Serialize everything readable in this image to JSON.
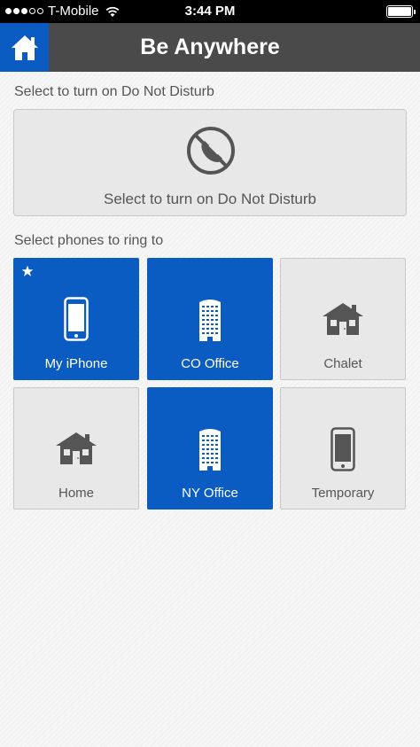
{
  "status_bar": {
    "carrier": "T-Mobile",
    "time": "3:44 PM"
  },
  "header": {
    "title": "Be Anywhere",
    "home_icon": "home-icon"
  },
  "dnd": {
    "section_label": "Select to turn on Do Not Disturb",
    "button_label": "Select to turn on Do Not Disturb",
    "icon": "phone-blocked-icon"
  },
  "phones": {
    "section_label": "Select phones to ring to",
    "items": [
      {
        "label": "My iPhone",
        "icon": "smartphone-icon",
        "selected": true,
        "favorite": true
      },
      {
        "label": "CO Office",
        "icon": "office-building-icon",
        "selected": true,
        "favorite": false
      },
      {
        "label": "Chalet",
        "icon": "house-icon",
        "selected": false,
        "favorite": false
      },
      {
        "label": "Home",
        "icon": "house-icon",
        "selected": false,
        "favorite": false
      },
      {
        "label": "NY Office",
        "icon": "office-building-icon",
        "selected": true,
        "favorite": false
      },
      {
        "label": "Temporary",
        "icon": "smartphone-icon",
        "selected": false,
        "favorite": false
      }
    ]
  },
  "colors": {
    "accent": "#0a5cc2",
    "header_bg": "#4a4a4a",
    "tile_off_bg": "#e8e8e8",
    "icon_gray": "#555555"
  }
}
